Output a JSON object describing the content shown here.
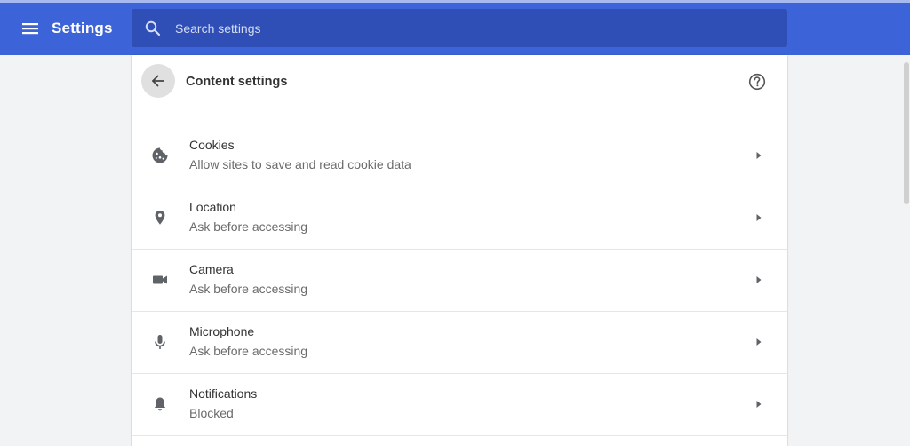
{
  "header": {
    "menu_icon": "hamburger-menu-icon",
    "title": "Settings",
    "search": {
      "placeholder": "Search settings",
      "value": "",
      "icon": "search-icon"
    },
    "bar_color": "#3d63d8"
  },
  "page": {
    "back_icon": "arrow-back-icon",
    "title": "Content settings",
    "help_icon": "help-circle-icon"
  },
  "items": [
    {
      "title": "Cookies",
      "subtitle": "Allow sites to save and read cookie data",
      "icon": "cookie-icon"
    },
    {
      "title": "Location",
      "subtitle": "Ask before accessing",
      "icon": "location-pin-icon"
    },
    {
      "title": "Camera",
      "subtitle": "Ask before accessing",
      "icon": "videocam-icon"
    },
    {
      "title": "Microphone",
      "subtitle": "Ask before accessing",
      "icon": "microphone-icon"
    },
    {
      "title": "Notifications",
      "subtitle": "Blocked",
      "icon": "bell-icon"
    }
  ]
}
